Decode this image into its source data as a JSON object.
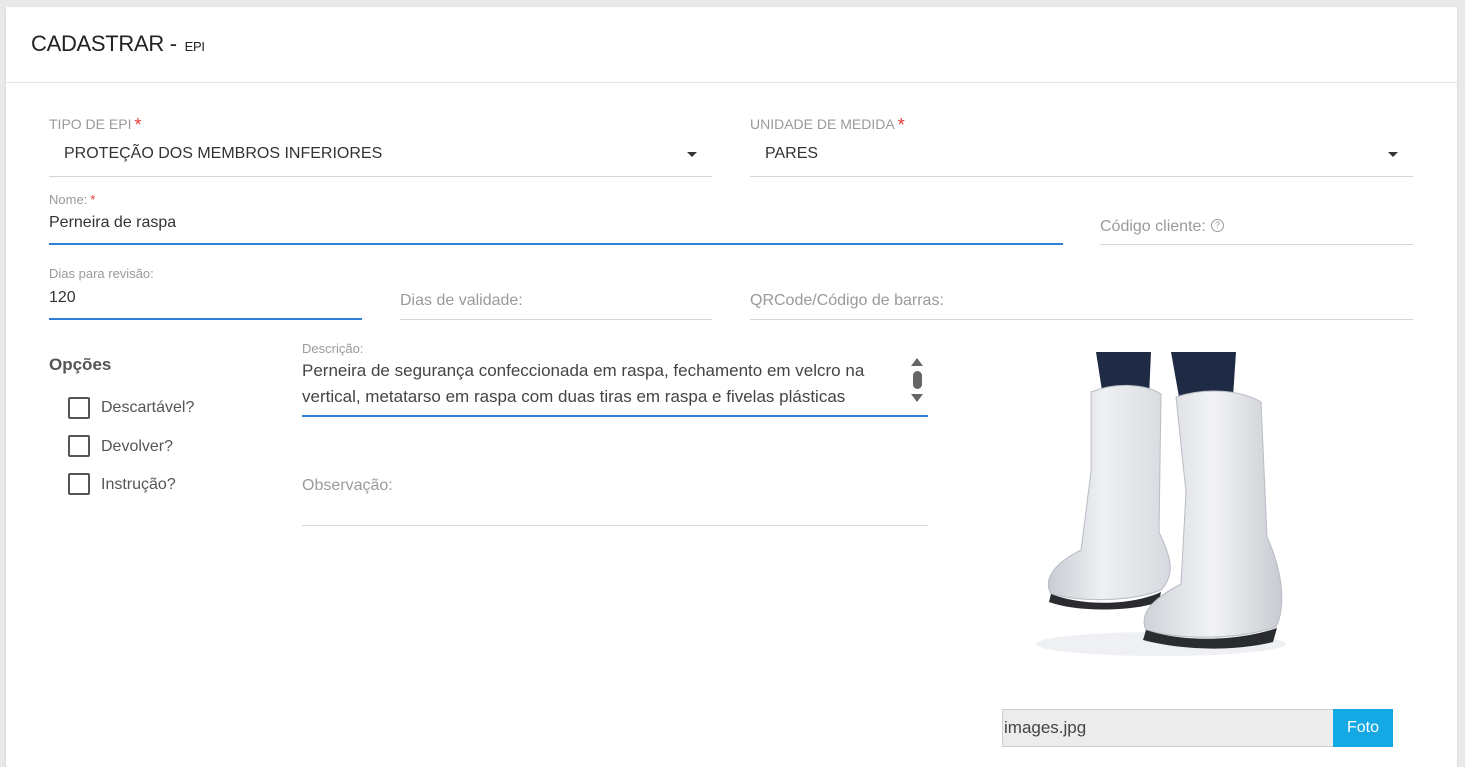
{
  "header": {
    "title": "CADASTRAR -",
    "subtitle": "EPI"
  },
  "tipo_epi": {
    "label": "TIPO DE EPI",
    "required_mark": "*",
    "value": "PROTEÇÃO DOS MEMBROS INFERIORES"
  },
  "unidade_medida": {
    "label": "UNIDADE DE MEDIDA",
    "required_mark": "*",
    "value": "PARES"
  },
  "nome": {
    "label": "Nome:",
    "required_mark": "*",
    "value": "Perneira de raspa"
  },
  "codigo_cliente": {
    "placeholder": "Código cliente:",
    "help_glyph": "?"
  },
  "dias_revisao": {
    "label": "Dias para revisão:",
    "value": "120"
  },
  "dias_validade": {
    "placeholder": "Dias de validade:"
  },
  "qrcode": {
    "placeholder": "QRCode/Código de barras:"
  },
  "opcoes": {
    "title": "Opções",
    "items": [
      {
        "label": "Descartável?",
        "checked": false
      },
      {
        "label": "Devolver?",
        "checked": false
      },
      {
        "label": "Instrução?",
        "checked": false
      }
    ]
  },
  "descricao": {
    "label": "Descrição:",
    "line1": "Perneira de segurança confeccionada em raspa, fechamento em velcro na",
    "line2": "vertical, metatarso em raspa com duas tiras em raspa e fivelas plásticas"
  },
  "observacao": {
    "placeholder": "Observação:"
  },
  "photo": {
    "filename": "images.jpg",
    "button_label": "Foto"
  },
  "colors": {
    "accent": "#2f80d6",
    "required": "#e53935",
    "button": "#14a9e5"
  }
}
